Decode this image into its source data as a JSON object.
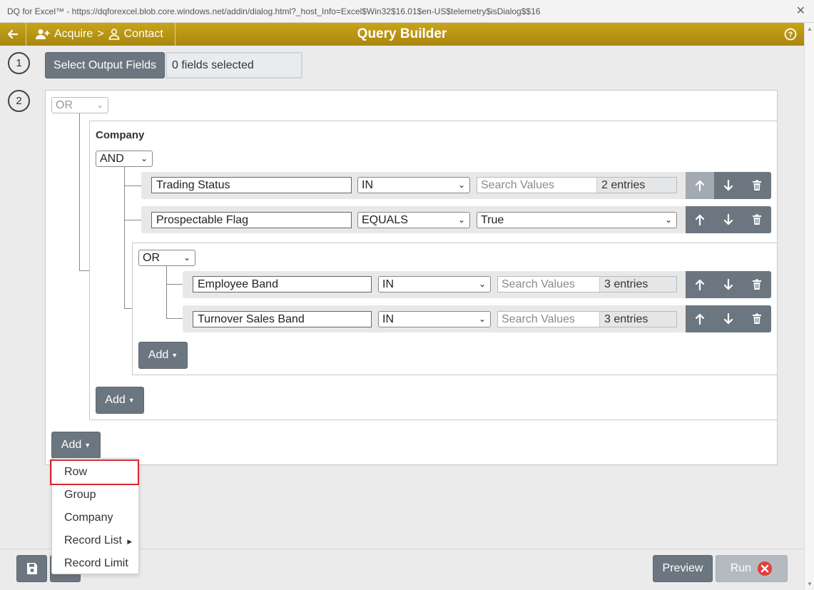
{
  "window": {
    "title": "DQ for Excel™ - https://dqforexcel.blob.core.windows.net/addin/dialog.html?_host_Info=Excel$Win32$16.01$en-US$telemetry$isDialog$$16"
  },
  "header": {
    "breadcrumb_acquire": "Acquire",
    "breadcrumb_separator": ">",
    "breadcrumb_contact": "Contact",
    "title": "Query Builder",
    "accent_color": "#b8951a"
  },
  "step1": {
    "number": "1",
    "button_label": "Select Output Fields",
    "fields_selected": "0 fields selected"
  },
  "step2": {
    "number": "2",
    "root_operator": "OR",
    "company_group": {
      "label": "Company",
      "operator": "AND",
      "rows": [
        {
          "field": "Trading Status",
          "operator": "IN",
          "search_placeholder": "Search Values",
          "entries": "2 entries"
        },
        {
          "field": "Prospectable Flag",
          "operator": "EQUALS",
          "value": "True"
        }
      ],
      "subgroup": {
        "operator": "OR",
        "rows": [
          {
            "field": "Employee Band",
            "operator": "IN",
            "search_placeholder": "Search Values",
            "entries": "3 entries"
          },
          {
            "field": "Turnover Sales Band",
            "operator": "IN",
            "search_placeholder": "Search Values",
            "entries": "3 entries"
          }
        ],
        "add_label": "Add"
      },
      "add_label": "Add"
    },
    "add_label": "Add"
  },
  "add_menu": {
    "items": [
      "Row",
      "Group",
      "Company",
      "Record List",
      "Record Limit"
    ]
  },
  "footer": {
    "preview_label": "Preview",
    "run_label": "Run"
  }
}
